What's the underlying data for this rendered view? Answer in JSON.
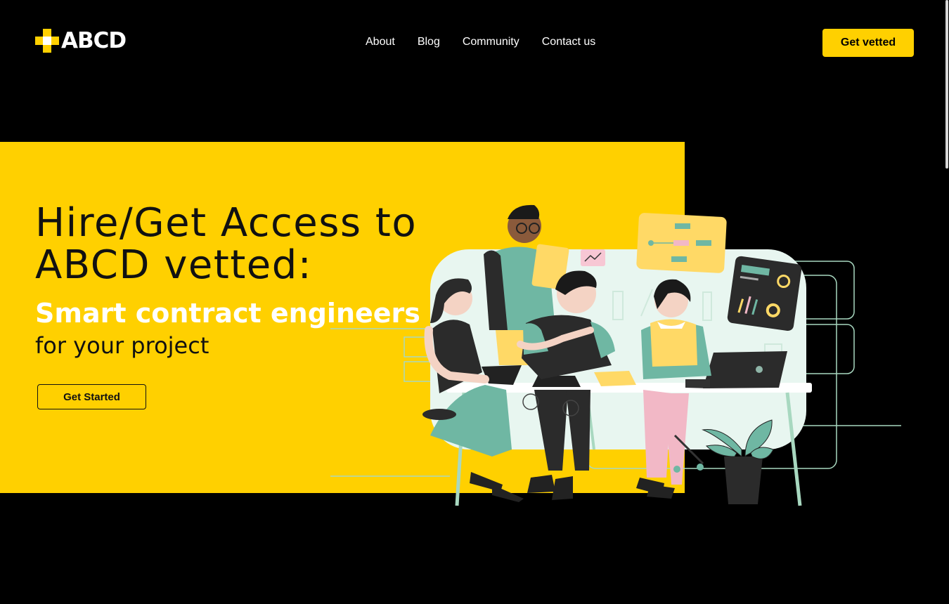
{
  "brand": {
    "name": "ABCD",
    "accent_color": "#ffd000"
  },
  "nav": {
    "items": [
      {
        "label": "About"
      },
      {
        "label": "Blog"
      },
      {
        "label": "Community"
      },
      {
        "label": "Contact us"
      }
    ],
    "cta_label": "Get vetted"
  },
  "hero": {
    "headline_line1": "Hire/Get Access to",
    "headline_line2": "ABCD vetted:",
    "subheadline": "Smart contract engineers",
    "tagline": "for your project",
    "button_label": "Get Started"
  },
  "illustration": {
    "icon": "team-working-at-desk-illustration"
  }
}
